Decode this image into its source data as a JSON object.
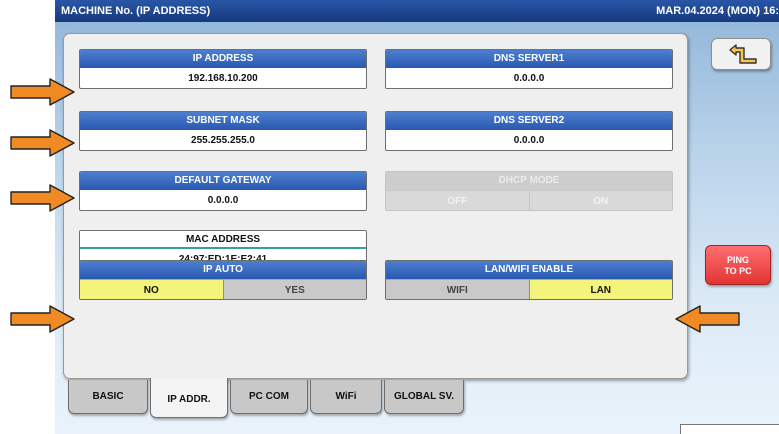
{
  "title": "MACHINE No. (IP ADDRESS)",
  "datetime": "MAR.04.2024 (MON) 16:",
  "fields": {
    "ip_address": {
      "label": "IP ADDRESS",
      "value": "192.168.10.200"
    },
    "dns_server1": {
      "label": "DNS SERVER1",
      "value": "0.0.0.0"
    },
    "subnet_mask": {
      "label": "SUBNET MASK",
      "value": "255.255.255.0"
    },
    "dns_server2": {
      "label": "DNS SERVER2",
      "value": "0.0.0.0"
    },
    "default_gateway": {
      "label": "DEFAULT GATEWAY",
      "value": "0.0.0.0"
    },
    "dhcp_mode": {
      "label": "DHCP MODE",
      "off": "OFF",
      "on": "ON"
    },
    "mac_address": {
      "label": "MAC ADDRESS",
      "value": "24:97:ED:1E:E2:41"
    },
    "ip_auto": {
      "label": "IP AUTO",
      "no": "NO",
      "yes": "YES",
      "selected": "NO"
    },
    "lan_wifi_enable": {
      "label": "LAN/WIFI ENABLE",
      "wifi": "WIFI",
      "lan": "LAN",
      "selected": "LAN"
    }
  },
  "tabs": [
    "BASIC",
    "IP ADDR.",
    "PC COM",
    "WiFi",
    "GLOBAL SV."
  ],
  "active_tab": "IP ADDR.",
  "buttons": {
    "ping_line1": "PING",
    "ping_line2": "TO PC",
    "back_icon": "return-arrow-icon"
  },
  "colors": {
    "header_blue": "#2859b0",
    "selected_yellow": "#f4f47d",
    "ping_red": "#e43434",
    "arrow_orange": "#f08a24"
  }
}
